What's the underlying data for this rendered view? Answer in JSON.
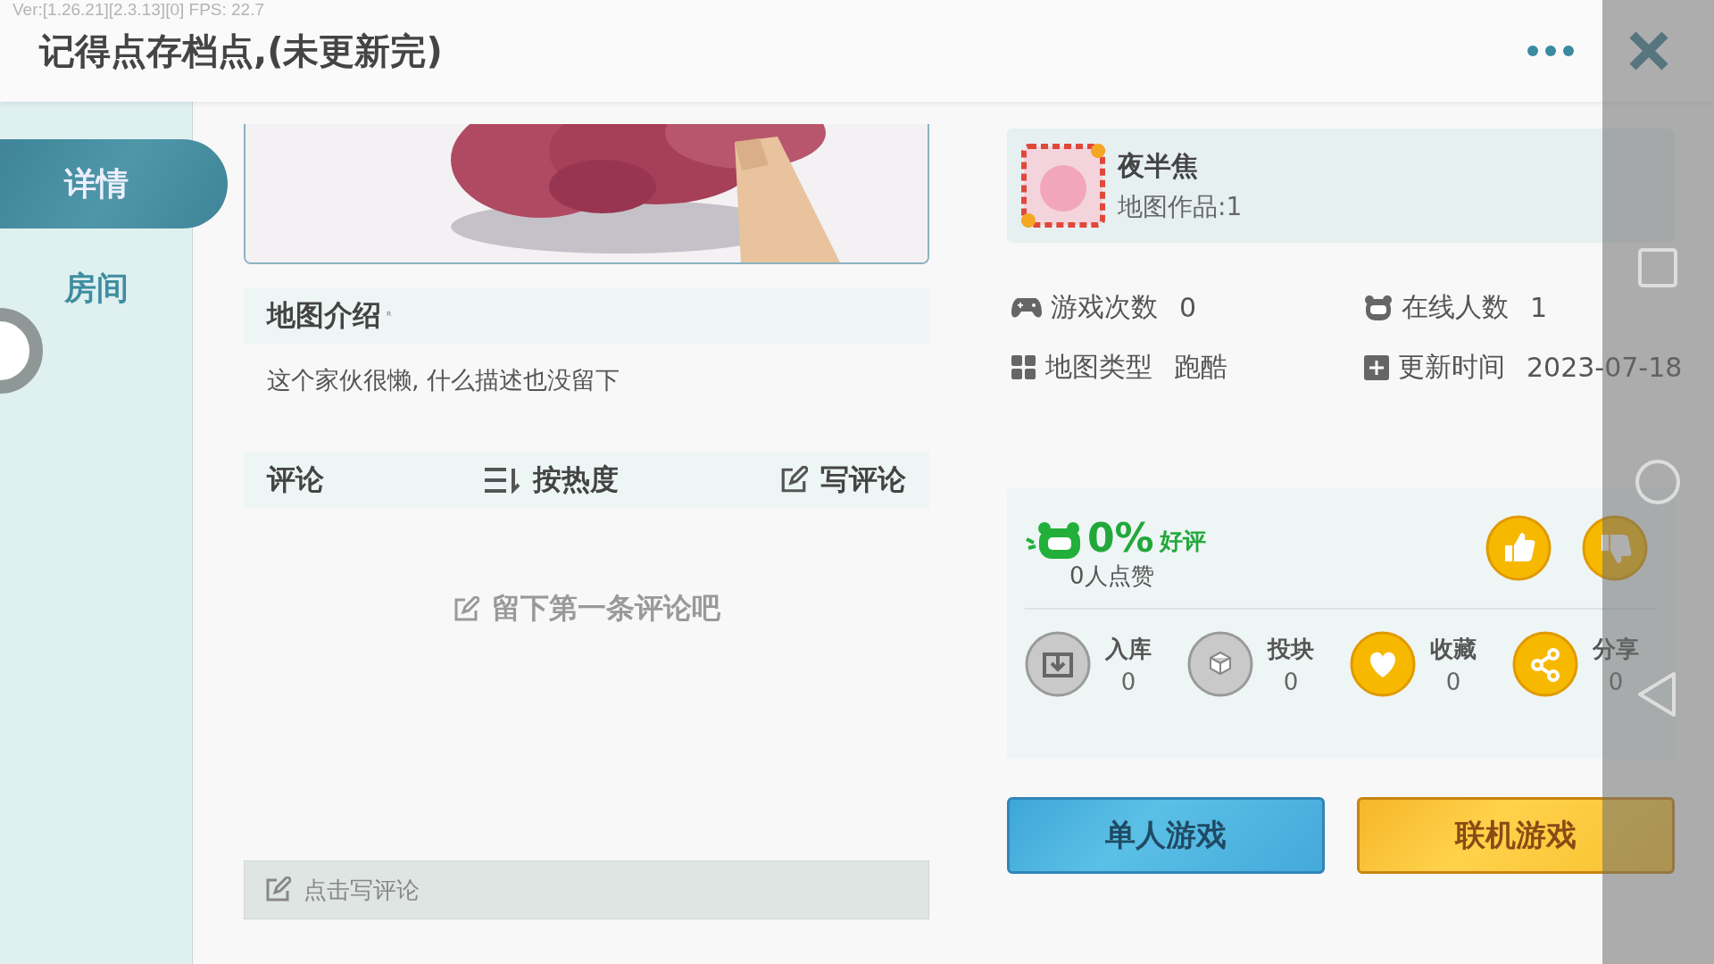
{
  "debug_overlay": "Ver:[1.26.21][2.3.13][0] FPS: 22.7",
  "header": {
    "title": "记得点存档点,(未更新完)"
  },
  "sidebar": {
    "tabs": [
      {
        "label": "详情",
        "selected": true
      },
      {
        "label": "房间",
        "selected": false
      }
    ]
  },
  "map": {
    "intro_title": "地图介绍",
    "intro_mark": "ᴿ",
    "description": "这个家伙很懒, 什么描述也没留下"
  },
  "comments": {
    "title": "评论",
    "sort": "按热度",
    "write": "写评论",
    "empty": "留下第一条评论吧",
    "input_placeholder": "点击写评论"
  },
  "author": {
    "name": "夜半焦",
    "works": "地图作品:1"
  },
  "stats": [
    {
      "kind": "plays",
      "label": "游戏次数",
      "value": "0"
    },
    {
      "kind": "online",
      "label": "在线人数",
      "value": "1"
    },
    {
      "kind": "type",
      "label": "地图类型",
      "value": "跑酷"
    },
    {
      "kind": "updated",
      "label": "更新时间",
      "value": "2023-07-18"
    }
  ],
  "rating": {
    "percent": "0%",
    "label": "好评",
    "likes": "0人点赞"
  },
  "actions": [
    {
      "kind": "download",
      "label": "入库",
      "count": "0",
      "active": false
    },
    {
      "kind": "block",
      "label": "投块",
      "count": "0",
      "active": false
    },
    {
      "kind": "favorite",
      "label": "收藏",
      "count": "0",
      "active": true
    },
    {
      "kind": "share",
      "label": "分享",
      "count": "0",
      "active": true
    }
  ],
  "buttons": [
    {
      "kind": "single",
      "label": "单人游戏"
    },
    {
      "kind": "multi",
      "label": "联机游戏"
    }
  ]
}
